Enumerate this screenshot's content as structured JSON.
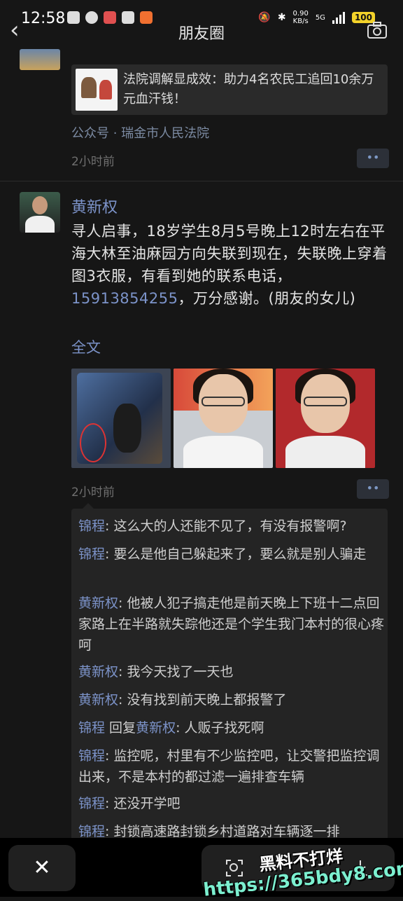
{
  "status": {
    "time": "12:58",
    "net_speed": "0.90",
    "net_unit": "KB/s",
    "net_type": "5G",
    "battery": "100"
  },
  "header": {
    "title": "朋友圈"
  },
  "feed": {
    "prev_post": {
      "link_title": "法院调解显成效：助力4名农民工追回10余万元血汗钱！",
      "source": "公众号 · 瑞金市人民法院",
      "time_ago": "2小时前",
      "more": "••"
    },
    "post": {
      "author": "黄新权",
      "text": "寻人启事，18岁学生8月5号晚上12时左右在平海大林至油麻园方向失联到现在，失联晚上穿着图3衣服，有看到她的联系电话，",
      "phone": "15913854255",
      "text_end": "，万分感谢。(朋友的女儿)",
      "full_text_link": "全文",
      "time_ago": "2小时前",
      "more": "••",
      "comments": [
        {
          "name": "锦程",
          "text": ": 这么大的人还能不见了，有没有报警啊?"
        },
        {
          "name": "锦程",
          "text": ": 要么是他自己躲起来了，要么就是别人骗走"
        },
        {
          "name": "黄新权",
          "text": ": 他被人犯子搞走他是前天晚上下班十二点回家路上在半路就失踪他还是个学生我门本村的很心疼呵"
        },
        {
          "name": "黄新权",
          "text": ": 我今天找了一天也"
        },
        {
          "name": "黄新权",
          "text": ": 没有找到前天晚上都报警了"
        },
        {
          "name": "锦程",
          "reply_word": " 回复",
          "reply_to": "黄新权",
          "text": ": 人贩子找死啊"
        },
        {
          "name": "锦程",
          "text": ": 监控呢，村里有不少监控吧，让交警把监控调出来，不是本村的都过滤一遍排查车辆"
        },
        {
          "name": "锦程",
          "text": ": 还没开学吧"
        },
        {
          "name": "锦程",
          "text": ": 封锁高速路封锁乡村道路对车辆逐一排"
        }
      ]
    }
  },
  "bottom": {
    "close": "✕"
  },
  "watermark": {
    "line1": "黑料不打烊",
    "line2": "https://365bdy8.com"
  }
}
